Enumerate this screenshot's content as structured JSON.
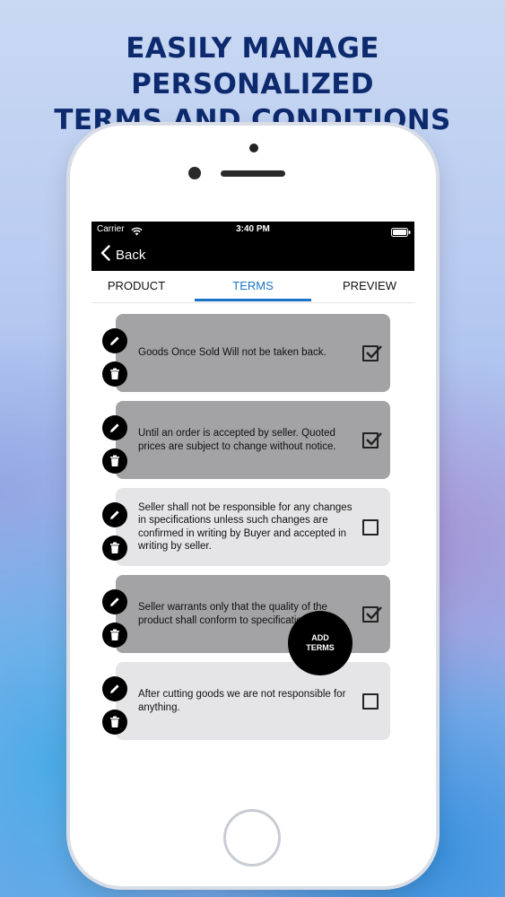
{
  "headline": {
    "line1": "EASILY MANAGE PERSONALIZED",
    "line2": "TERMS AND CONDITIONS"
  },
  "status_bar": {
    "carrier": "Carrier",
    "time": "3:40 PM"
  },
  "nav": {
    "back_label": "Back"
  },
  "tabs": [
    {
      "label": "PRODUCT",
      "active": false
    },
    {
      "label": "TERMS",
      "active": true
    },
    {
      "label": "PREVIEW",
      "active": false
    }
  ],
  "terms": [
    {
      "text": "Goods Once Sold Will not be taken back.",
      "checked": true
    },
    {
      "text": "Until an order is accepted by seller. Quoted prices are subject to change without notice.",
      "checked": true
    },
    {
      "text": "Seller shall not be responsible for any changes in specifications unless such changes are confirmed in writing by Buyer and accepted in writing by seller.",
      "checked": false
    },
    {
      "text": "Seller warrants only that the quality of the product shall conform to specifications.",
      "checked": true
    },
    {
      "text": "After cutting goods we are not responsible for anything.",
      "checked": false
    }
  ],
  "fab": {
    "line1": "ADD",
    "line2": "TERMS"
  },
  "colors": {
    "headline": "#0d2a6e",
    "active_tab": "#1a73c8",
    "checked_card": "#a3a3a5",
    "unchecked_card": "#e5e5e7"
  }
}
